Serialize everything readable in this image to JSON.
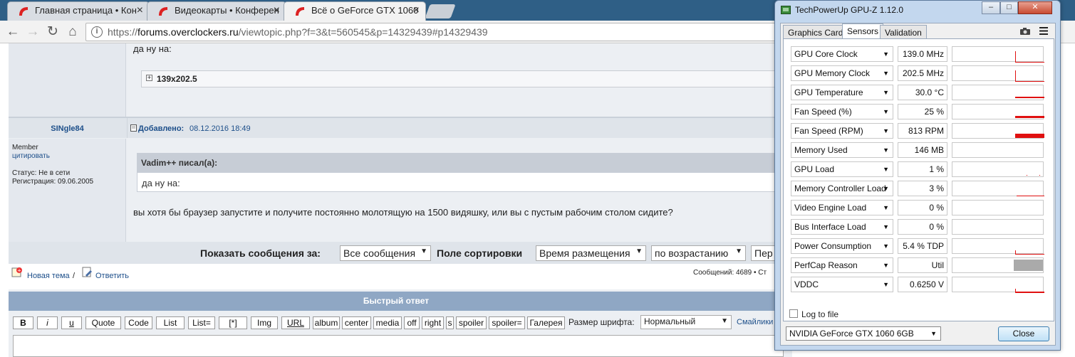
{
  "browser": {
    "tabs": [
      {
        "title": "Главная страница • Кон"
      },
      {
        "title": "Видеокарты • Конферен"
      },
      {
        "title": "Всё о GeForce GTX 1060"
      }
    ],
    "tab_close": "×",
    "url_scheme": "https://",
    "url_host": "forums.overclockers.ru",
    "url_path": "/viewtopic.php?f=3&t=560545&p=14329439#p14329439"
  },
  "forum": {
    "top_post_text": "да ну на:",
    "spoiler_title": "139x202.5",
    "post": {
      "author": "SINgle84",
      "added_label": "Добавлено:",
      "added_date": "08.12.2016 18:49",
      "rank": "Member",
      "quote_link": "цитировать",
      "status": "Статус: Не в сети",
      "registration": "Регистрация: 09.06.2005",
      "quote_header": "Vadim++ писал(а):",
      "quote_text": "да ну на:",
      "body": "вы хотя бы браузер запустите и получите постоянно молотящую на 1500 видяшку, или вы с пустым рабочим столом сидите?"
    },
    "sort_bar": {
      "show_label": "Показать сообщения за:",
      "show_value": "Все сообщения",
      "sort_label": "Поле сортировки",
      "sort_value": "Время размещения",
      "order_value": "по возрастанию",
      "go_value": "Пер"
    },
    "actions": {
      "new_topic": "Новая тема",
      "separator": "/",
      "reply": "Ответить",
      "messages_count": "Сообщений: 4689 • Ст"
    },
    "quick_reply": {
      "title": "Быстрый ответ",
      "buttons": [
        "B",
        "i",
        "u",
        "Quote",
        "Code",
        "List",
        "List=",
        "[*]",
        "Img",
        "URL",
        "album",
        "center",
        "media",
        "off",
        "right",
        "s",
        "spoiler",
        "spoiler=",
        "Галерея"
      ],
      "font_size_label": "Размер шрифта:",
      "font_size_value": "Нормальный",
      "smileys_link": "Смайлики"
    }
  },
  "gpuz": {
    "title": "TechPowerUp GPU-Z 1.12.0",
    "tabs": [
      "Graphics Card",
      "Sensors",
      "Validation"
    ],
    "active_tab": "Sensors",
    "sensors": [
      {
        "name": "GPU Core Clock",
        "value": "139.0 MHz"
      },
      {
        "name": "GPU Memory Clock",
        "value": "202.5 MHz"
      },
      {
        "name": "GPU Temperature",
        "value": "30.0 °C"
      },
      {
        "name": "Fan Speed (%)",
        "value": "25 %"
      },
      {
        "name": "Fan Speed (RPM)",
        "value": "813 RPM"
      },
      {
        "name": "Memory Used",
        "value": "146 MB"
      },
      {
        "name": "GPU Load",
        "value": "1 %"
      },
      {
        "name": "Memory Controller Load",
        "value": "3 %"
      },
      {
        "name": "Video Engine Load",
        "value": "0 %"
      },
      {
        "name": "Bus Interface Load",
        "value": "0 %"
      },
      {
        "name": "Power Consumption",
        "value": "5.4 % TDP"
      },
      {
        "name": "PerfCap Reason",
        "value": "Util"
      },
      {
        "name": "VDDC",
        "value": "0.6250 V"
      }
    ],
    "log_to_file": "Log to file",
    "gpu_select": "NVIDIA GeForce GTX 1060 6GB",
    "close_button": "Close",
    "accent_color": "#e01010"
  }
}
